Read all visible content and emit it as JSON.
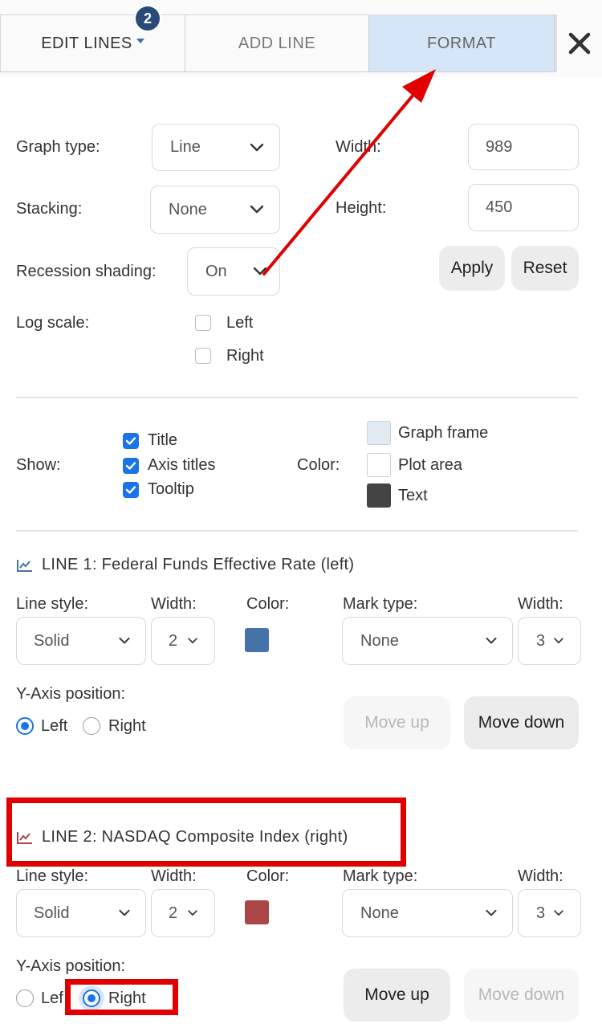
{
  "tabs": {
    "edit_lines": "EDIT LINES",
    "edit_badge": "2",
    "add_line": "ADD LINE",
    "format": "FORMAT"
  },
  "graph": {
    "graph_type_label": "Graph type:",
    "graph_type_value": "Line",
    "stacking_label": "Stacking:",
    "stacking_value": "None",
    "recession_label": "Recession shading:",
    "recession_value": "On",
    "log_scale_label": "Log scale:",
    "log_left": "Left",
    "log_right": "Right",
    "width_label": "Width:",
    "width_value": "989",
    "height_label": "Height:",
    "height_value": "450",
    "apply": "Apply",
    "reset": "Reset"
  },
  "display": {
    "show_label": "Show:",
    "title": "Title",
    "axis_titles": "Axis titles",
    "tooltip": "Tooltip",
    "color_label": "Color:",
    "graph_frame": "Graph frame",
    "plot_area": "Plot area",
    "text": "Text",
    "graph_frame_color": "#e2ebf4",
    "plot_area_color": "#ffffff",
    "text_color": "#444444"
  },
  "lines": [
    {
      "title": "LINE 1: Federal Funds Effective Rate (left)",
      "line_style_label": "Line style:",
      "line_style": "Solid",
      "width_label": "Width:",
      "width": "2",
      "color_label": "Color:",
      "color": "#4572a7",
      "mark_type_label": "Mark type:",
      "mark_type": "None",
      "mark_width_label": "Width:",
      "mark_width": "3",
      "y_axis_label": "Y-Axis position:",
      "left": "Left",
      "right": "Right",
      "move_up": "Move up",
      "move_down": "Move down"
    },
    {
      "title": "LINE 2: NASDAQ Composite Index (right)",
      "line_style_label": "Line style:",
      "line_style": "Solid",
      "width_label": "Width:",
      "width": "2",
      "color_label": "Color:",
      "color": "#aa4643",
      "mark_type_label": "Mark type:",
      "mark_type": "None",
      "mark_width_label": "Width:",
      "mark_width": "3",
      "y_axis_label": "Y-Axis position:",
      "left": "Lef",
      "right": "Right",
      "move_up": "Move up",
      "move_down": "Move down"
    }
  ]
}
